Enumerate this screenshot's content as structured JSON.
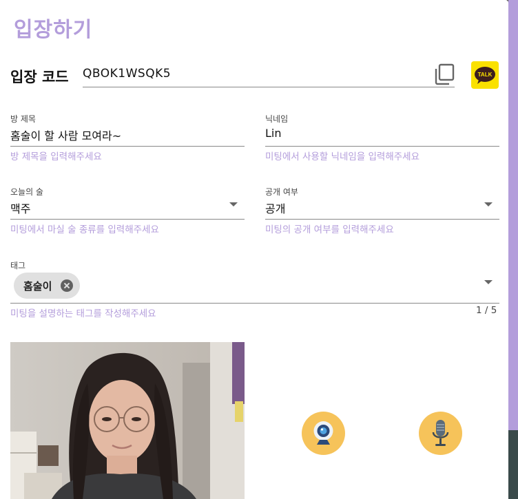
{
  "dialog": {
    "title": "입장하기"
  },
  "entry_code": {
    "label": "입장 코드",
    "value": "QBOK1WSQK5"
  },
  "kakao": {
    "badge_text": "TALK"
  },
  "room_title": {
    "label": "방 제목",
    "value": "홈술이 할 사람 모여라~",
    "helper": "방 제목을 입력해주세요"
  },
  "nickname": {
    "label": "닉네임",
    "value": "Lin",
    "helper": "미팅에서 사용할 닉네임을 입력해주세요"
  },
  "drink": {
    "label": "오늘의 술",
    "value": "맥주",
    "helper": "미팅에서 마실 술 종류를 입력해주세요"
  },
  "visibility": {
    "label": "공개 여부",
    "value": "공개",
    "helper": "미팅의 공개 여부를 입력해주세요"
  },
  "tags": {
    "label": "태그",
    "chips": [
      "홈술이"
    ],
    "helper": "미팅을 설명하는 태그를 작성해주세요",
    "counter": "1 / 5"
  },
  "media": {
    "camera_icon": "webcam-icon",
    "mic_icon": "microphone-icon"
  },
  "colors": {
    "accent": "#b39ddb",
    "kakao": "#fae100",
    "media_button": "#f6c35a"
  }
}
